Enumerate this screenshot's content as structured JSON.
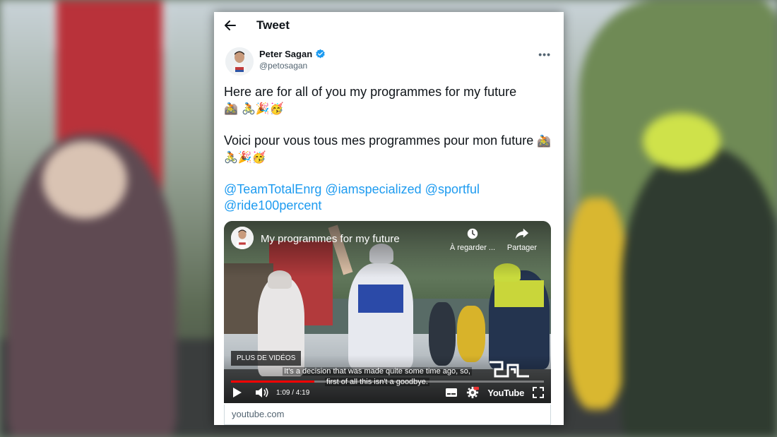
{
  "tweet_page": {
    "title": "Tweet",
    "author": {
      "name": "Peter Sagan",
      "handle": "@petosagan",
      "verified": true
    },
    "paragraphs": [
      {
        "text": "Here are for all of you my programmes for my future",
        "emojis": "🚵 🚴🎉🥳"
      },
      {
        "text": "Voici pour vous tous mes programmes pour mon future",
        "emojis": "🚵 🚴🎉🥳"
      }
    ],
    "mentions": [
      "@TeamTotalEnrg",
      "@iamspecialized",
      "@sportful",
      "@ride100percent"
    ],
    "video": {
      "title": "My programmes for my future",
      "watch_later_label": "À regarder ...",
      "share_label": "Partager",
      "more_videos_label": "PLUS DE VIDÉOS",
      "caption_line1": "It's a decision that was made quite some time ago, so,",
      "caption_line2": "first of all this isn't a goodbye.",
      "time": "1:09 / 4:19",
      "progress": 0.266,
      "brand": "YouTube",
      "domain": "youtube.com"
    }
  },
  "colors": {
    "link": "#1d9bf0",
    "verified": "#1d9bf0",
    "progress": "#ff0000",
    "text_primary": "#0f1419",
    "text_secondary": "#536471"
  },
  "icons": {
    "back": "arrow-left-icon",
    "verified": "verified-badge-icon",
    "more": "more-horizontal-icon",
    "watch_later": "clock-icon",
    "share": "share-arrow-icon",
    "play": "play-icon",
    "volume": "volume-icon",
    "subtitles": "subtitles-icon",
    "settings": "gear-icon",
    "fullscreen": "fullscreen-icon"
  }
}
